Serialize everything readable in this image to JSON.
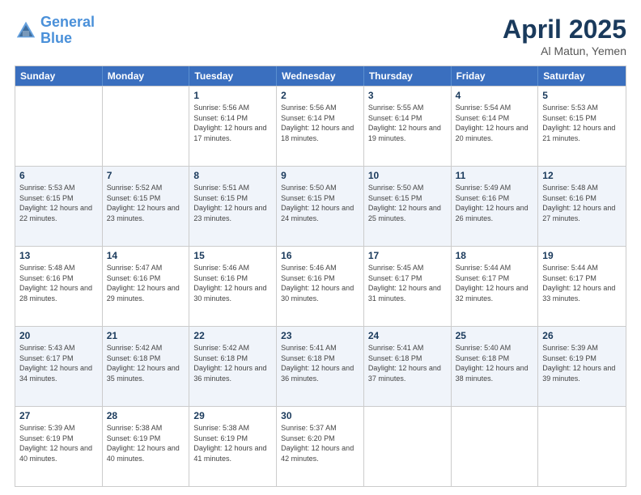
{
  "header": {
    "logo_line1": "General",
    "logo_line2": "Blue",
    "title": "April 2025",
    "subtitle": "Al Matun, Yemen"
  },
  "days": [
    "Sunday",
    "Monday",
    "Tuesday",
    "Wednesday",
    "Thursday",
    "Friday",
    "Saturday"
  ],
  "weeks": [
    [
      {
        "day": "",
        "info": ""
      },
      {
        "day": "",
        "info": ""
      },
      {
        "day": "1",
        "info": "Sunrise: 5:56 AM\nSunset: 6:14 PM\nDaylight: 12 hours and 17 minutes."
      },
      {
        "day": "2",
        "info": "Sunrise: 5:56 AM\nSunset: 6:14 PM\nDaylight: 12 hours and 18 minutes."
      },
      {
        "day": "3",
        "info": "Sunrise: 5:55 AM\nSunset: 6:14 PM\nDaylight: 12 hours and 19 minutes."
      },
      {
        "day": "4",
        "info": "Sunrise: 5:54 AM\nSunset: 6:14 PM\nDaylight: 12 hours and 20 minutes."
      },
      {
        "day": "5",
        "info": "Sunrise: 5:53 AM\nSunset: 6:15 PM\nDaylight: 12 hours and 21 minutes."
      }
    ],
    [
      {
        "day": "6",
        "info": "Sunrise: 5:53 AM\nSunset: 6:15 PM\nDaylight: 12 hours and 22 minutes."
      },
      {
        "day": "7",
        "info": "Sunrise: 5:52 AM\nSunset: 6:15 PM\nDaylight: 12 hours and 23 minutes."
      },
      {
        "day": "8",
        "info": "Sunrise: 5:51 AM\nSunset: 6:15 PM\nDaylight: 12 hours and 23 minutes."
      },
      {
        "day": "9",
        "info": "Sunrise: 5:50 AM\nSunset: 6:15 PM\nDaylight: 12 hours and 24 minutes."
      },
      {
        "day": "10",
        "info": "Sunrise: 5:50 AM\nSunset: 6:15 PM\nDaylight: 12 hours and 25 minutes."
      },
      {
        "day": "11",
        "info": "Sunrise: 5:49 AM\nSunset: 6:16 PM\nDaylight: 12 hours and 26 minutes."
      },
      {
        "day": "12",
        "info": "Sunrise: 5:48 AM\nSunset: 6:16 PM\nDaylight: 12 hours and 27 minutes."
      }
    ],
    [
      {
        "day": "13",
        "info": "Sunrise: 5:48 AM\nSunset: 6:16 PM\nDaylight: 12 hours and 28 minutes."
      },
      {
        "day": "14",
        "info": "Sunrise: 5:47 AM\nSunset: 6:16 PM\nDaylight: 12 hours and 29 minutes."
      },
      {
        "day": "15",
        "info": "Sunrise: 5:46 AM\nSunset: 6:16 PM\nDaylight: 12 hours and 30 minutes."
      },
      {
        "day": "16",
        "info": "Sunrise: 5:46 AM\nSunset: 6:16 PM\nDaylight: 12 hours and 30 minutes."
      },
      {
        "day": "17",
        "info": "Sunrise: 5:45 AM\nSunset: 6:17 PM\nDaylight: 12 hours and 31 minutes."
      },
      {
        "day": "18",
        "info": "Sunrise: 5:44 AM\nSunset: 6:17 PM\nDaylight: 12 hours and 32 minutes."
      },
      {
        "day": "19",
        "info": "Sunrise: 5:44 AM\nSunset: 6:17 PM\nDaylight: 12 hours and 33 minutes."
      }
    ],
    [
      {
        "day": "20",
        "info": "Sunrise: 5:43 AM\nSunset: 6:17 PM\nDaylight: 12 hours and 34 minutes."
      },
      {
        "day": "21",
        "info": "Sunrise: 5:42 AM\nSunset: 6:18 PM\nDaylight: 12 hours and 35 minutes."
      },
      {
        "day": "22",
        "info": "Sunrise: 5:42 AM\nSunset: 6:18 PM\nDaylight: 12 hours and 36 minutes."
      },
      {
        "day": "23",
        "info": "Sunrise: 5:41 AM\nSunset: 6:18 PM\nDaylight: 12 hours and 36 minutes."
      },
      {
        "day": "24",
        "info": "Sunrise: 5:41 AM\nSunset: 6:18 PM\nDaylight: 12 hours and 37 minutes."
      },
      {
        "day": "25",
        "info": "Sunrise: 5:40 AM\nSunset: 6:18 PM\nDaylight: 12 hours and 38 minutes."
      },
      {
        "day": "26",
        "info": "Sunrise: 5:39 AM\nSunset: 6:19 PM\nDaylight: 12 hours and 39 minutes."
      }
    ],
    [
      {
        "day": "27",
        "info": "Sunrise: 5:39 AM\nSunset: 6:19 PM\nDaylight: 12 hours and 40 minutes."
      },
      {
        "day": "28",
        "info": "Sunrise: 5:38 AM\nSunset: 6:19 PM\nDaylight: 12 hours and 40 minutes."
      },
      {
        "day": "29",
        "info": "Sunrise: 5:38 AM\nSunset: 6:19 PM\nDaylight: 12 hours and 41 minutes."
      },
      {
        "day": "30",
        "info": "Sunrise: 5:37 AM\nSunset: 6:20 PM\nDaylight: 12 hours and 42 minutes."
      },
      {
        "day": "",
        "info": ""
      },
      {
        "day": "",
        "info": ""
      },
      {
        "day": "",
        "info": ""
      }
    ]
  ]
}
